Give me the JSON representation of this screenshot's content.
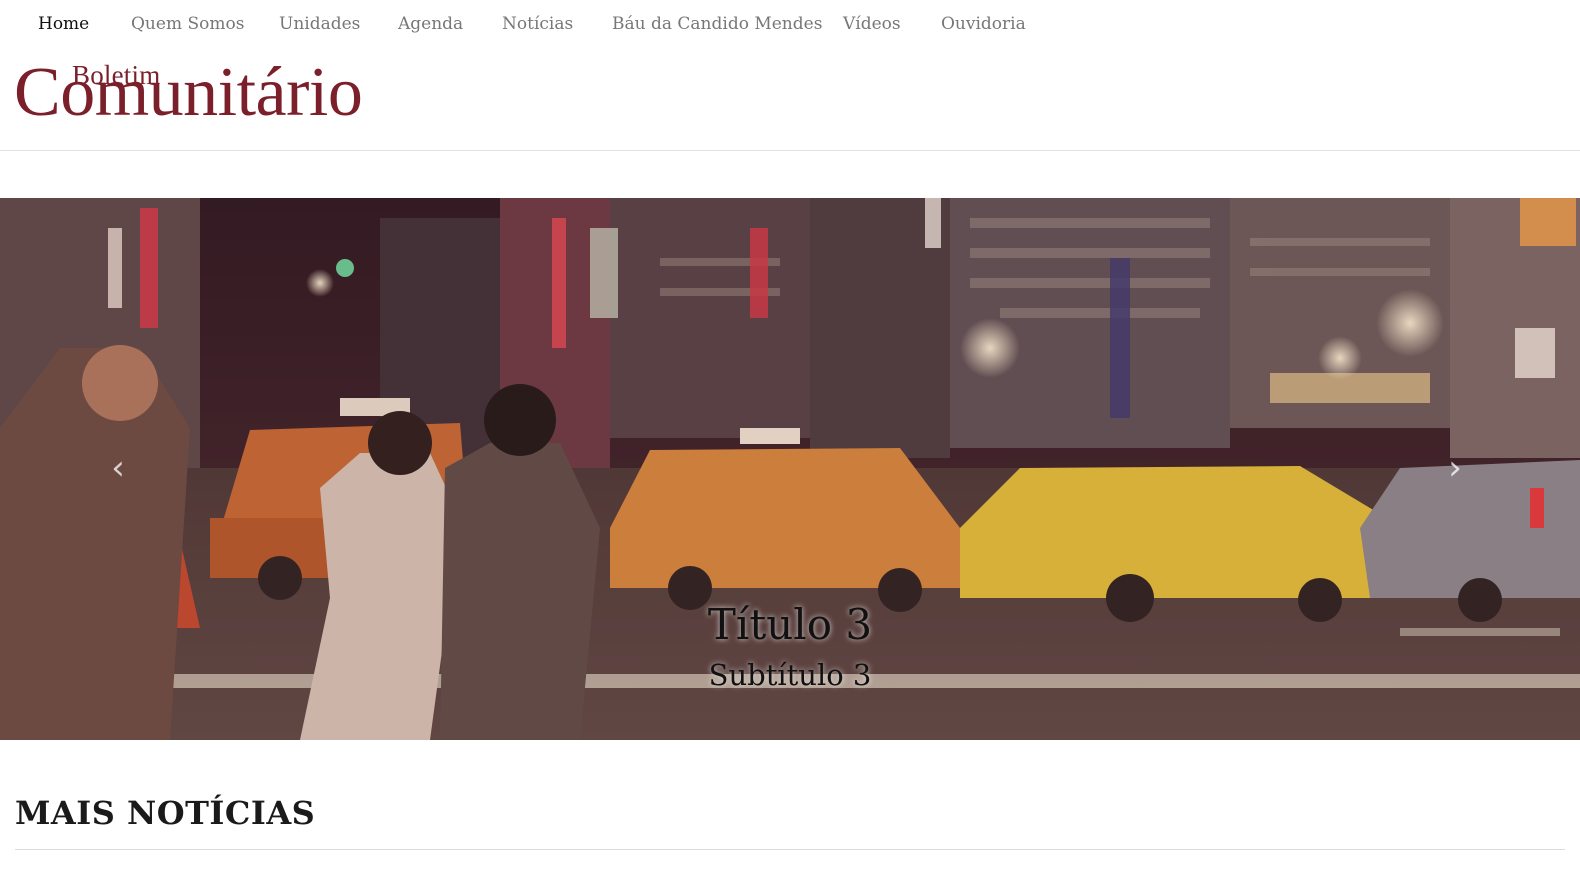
{
  "nav": {
    "items": [
      {
        "label": "Home",
        "active": true
      },
      {
        "label": "Quem Somos"
      },
      {
        "label": "Unidades"
      },
      {
        "label": "Agenda"
      },
      {
        "label": "Notícias"
      },
      {
        "label": "Báu da Candido Mendes"
      },
      {
        "label": "Vídeos"
      },
      {
        "label": "Ouvidoria"
      }
    ]
  },
  "logo": {
    "small": "Boletim",
    "large": "Comunitário",
    "color": "#7b1f2a"
  },
  "slider": {
    "title": "Título 3",
    "subtitle": "Subtítulo 3",
    "prev_icon": "chevron-left-icon",
    "next_icon": "chevron-right-icon"
  },
  "section": {
    "title": "MAIS NOTÍCIAS"
  }
}
